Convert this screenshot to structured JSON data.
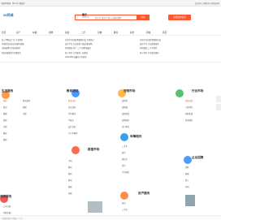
{
  "topbar": {
    "left": "中国本地网 - 58.com 换城市",
    "right": "会员中心 帮助中心 网站导航"
  },
  "header": {
    "logo": "58同城",
    "city": "肇庆",
    "city_sub": "[切换城市]",
    "search_placeholder": "找工作 找房子 输入关键词搜索",
    "search_button": "搜索",
    "post_button": "免费发布信息"
  },
  "nav": [
    "首页",
    "房产",
    "车辆",
    "招聘",
    "家政",
    "二手",
    "宠物",
    "教育",
    "商务",
    "同城",
    "黄页"
  ],
  "news_left": [
    "加入58精品广告 专业服务",
    "本地所有发布信息都有保障",
    "全国招聘平台优选推荐",
    "优质商家推荐 免费咨询"
  ],
  "news_mid": [
    "开创平台机遇 解锁新机会 不再错过",
    "高开学习 专业课程 升职必看攻略",
    "好物精选 房产 二手 招聘全覆盖",
    "新人特享 生活服务一站解决",
    "2022.08年度最佳平台服务"
  ],
  "news_right": [
    "开创平台机遇 解锁新机会",
    "高开学习 专业课程推荐",
    "好物精选 二手车推荐",
    "新人特享 汽车服务推荐"
  ],
  "categories": {
    "life": {
      "title": "生活服务",
      "items": [
        "家政",
        "保洁",
        "搬家",
        "维修",
        "开锁",
        "婚庆",
        "摄影",
        "家电维修",
        "保姆",
        "月嫂"
      ]
    },
    "edu": {
      "title": "教育培训",
      "items": [
        "职业培训",
        "语言培训",
        "学历教育",
        "IT培训",
        "设计培训",
        "中小学辅导"
      ]
    },
    "pets": {
      "title": "宠物市场",
      "items": [
        "宠物狗",
        "宠物猫",
        "宠物用品",
        "宠物服务",
        "花鸟鱼虫"
      ]
    },
    "biz": {
      "title": "行业市场",
      "items": [
        "机械设备",
        "工程承包",
        "农林牧渔",
        "商务服务"
      ]
    },
    "auto": {
      "title": "车辆相关",
      "items": [
        "二手车",
        "新车",
        "摩托车",
        "货车",
        "汽车服务"
      ]
    },
    "used": {
      "title": "跳蚤市场",
      "items": [
        "手机",
        "数码",
        "家具",
        "家电",
        "服装",
        "母婴"
      ]
    },
    "house": {
      "title": "房产服务",
      "items": [
        "新房",
        "二手房",
        "租房",
        "商铺",
        "写字楼"
      ]
    },
    "services": {
      "title": "商务服务",
      "items": [
        "公司注册",
        "代理记账",
        "装修服务",
        "广告设计"
      ]
    },
    "service2": {
      "title": "企业招聘",
      "items": [
        "销售",
        "客服",
        "普工",
        "司机"
      ]
    }
  },
  "footer": "中国本地网 58同城 © 2023"
}
